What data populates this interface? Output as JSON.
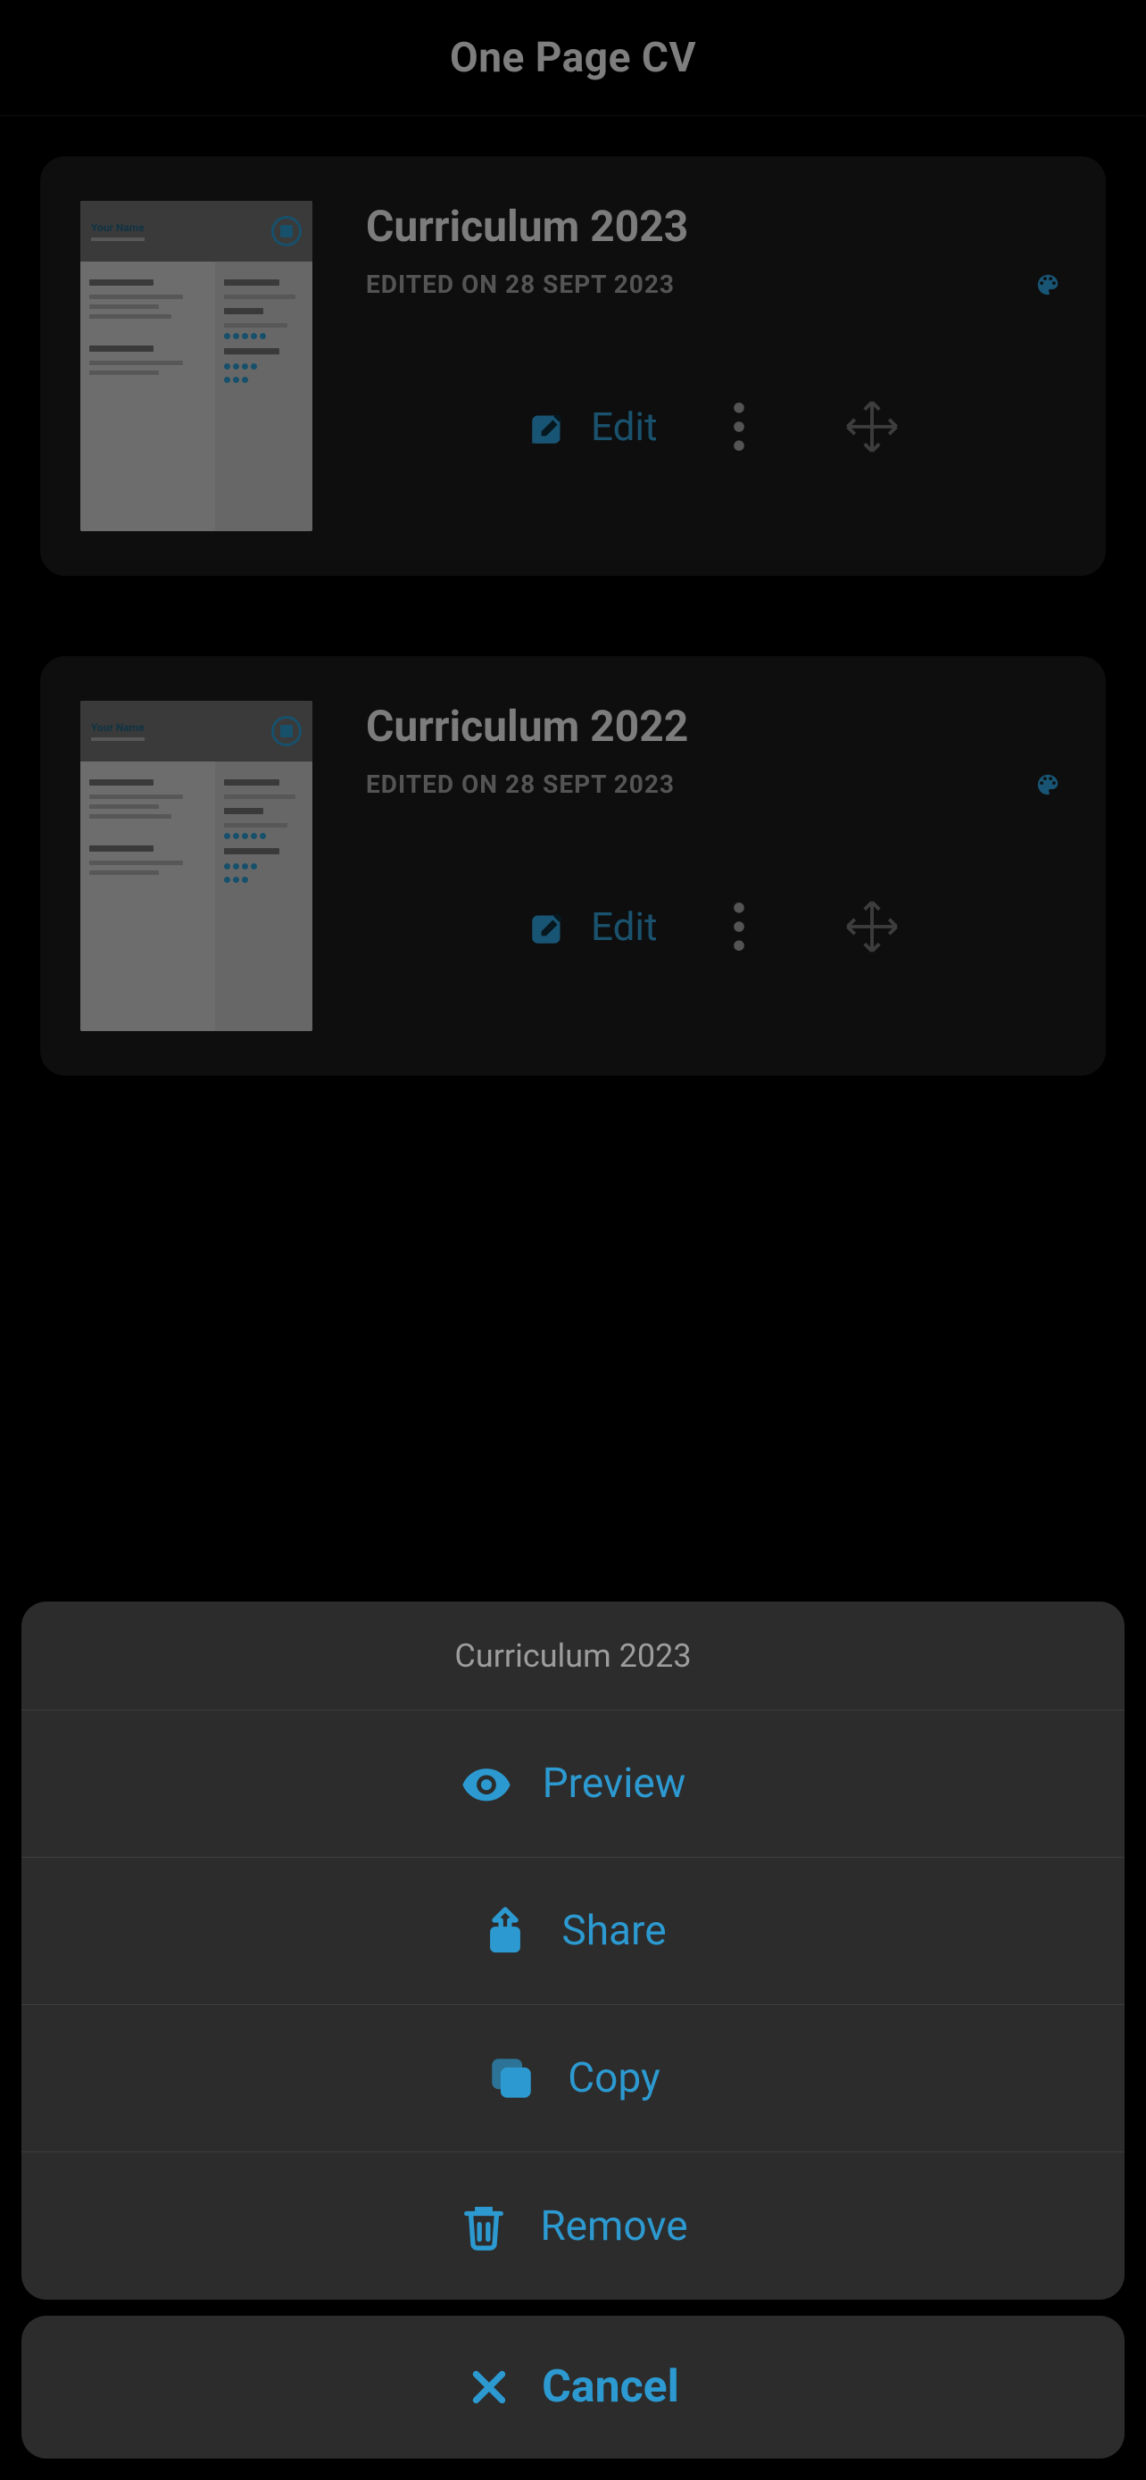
{
  "colors": {
    "accent": "#2c9ad1",
    "textPrimary": "#e2e2e2",
    "textSecondary": "#9a9a9a",
    "cardBg": "#1a1a1a",
    "sheetBg": "#2c2c2c",
    "dragIcon": "#6f6f6f"
  },
  "header": {
    "title": "One Page CV"
  },
  "documents": [
    {
      "title": "Curriculum 2023",
      "edited_prefix": "EDITED ON ",
      "edited_date": "28 SEPT 2023",
      "edit_label": "Edit"
    },
    {
      "title": "Curriculum 2022",
      "edited_prefix": "EDITED ON ",
      "edited_date": "28 SEPT 2023",
      "edit_label": "Edit"
    }
  ],
  "sheet": {
    "title": "Curriculum 2023",
    "items": [
      {
        "icon": "eye",
        "label": "Preview"
      },
      {
        "icon": "share",
        "label": "Share"
      },
      {
        "icon": "copy",
        "label": "Copy"
      },
      {
        "icon": "trash",
        "label": "Remove"
      }
    ],
    "cancel_label": "Cancel"
  }
}
